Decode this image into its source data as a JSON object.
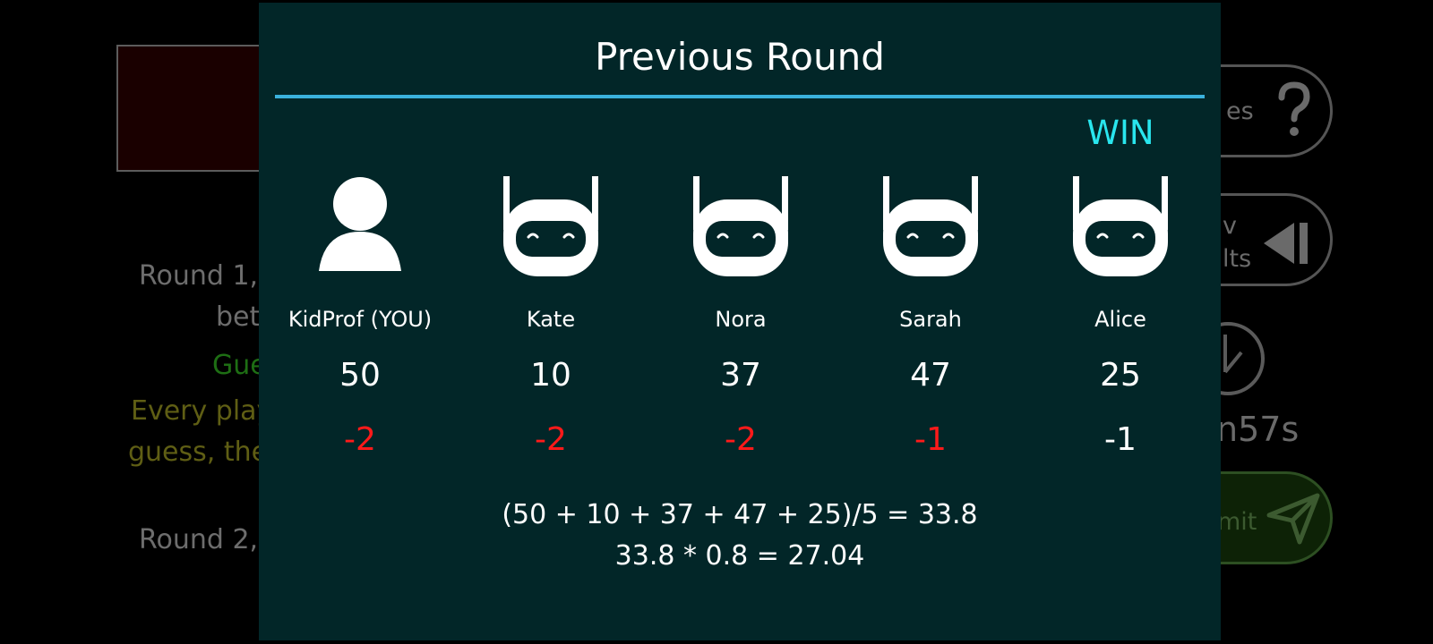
{
  "background": {
    "texts": [
      {
        "text": "Round 1,",
        "cls": "bg-gray"
      },
      {
        "text": "bet",
        "cls": "bg-gray"
      },
      {
        "text": "Gue",
        "cls": "bg-green"
      },
      {
        "text": "Every play",
        "cls": "bg-olive"
      },
      {
        "text": "guess, the",
        "cls": "bg-olive"
      },
      {
        "text": "Round 2,",
        "cls": "bg-gray"
      }
    ],
    "side_buttons": {
      "rules_partial": "es",
      "prev_results_line1": "v",
      "prev_results_line2": "lts",
      "timer_partial": "n57s",
      "submit_partial": "mit"
    }
  },
  "modal": {
    "title": "Previous Round",
    "win_label": "WIN",
    "players": [
      {
        "name": "KidProf (YOU)",
        "guess": "50",
        "score": "-2",
        "type": "human",
        "winner": false
      },
      {
        "name": "Kate",
        "guess": "10",
        "score": "-2",
        "type": "robot",
        "winner": false
      },
      {
        "name": "Nora",
        "guess": "37",
        "score": "-2",
        "type": "robot",
        "winner": false
      },
      {
        "name": "Sarah",
        "guess": "47",
        "score": "-1",
        "type": "robot",
        "winner": false
      },
      {
        "name": "Alice",
        "guess": "25",
        "score": "-1",
        "type": "robot",
        "winner": true
      }
    ],
    "formula_line1": "(50 + 10 + 37 + 47 + 25)/5 = 33.8",
    "formula_line2": "33.8 * 0.8 = 27.04"
  },
  "colors": {
    "modal_bg": "#022628",
    "divider": "#3ab1dc",
    "win": "#29e6ee",
    "loss_score": "#ff1a1a",
    "winner_score": "#ffffff"
  },
  "icons": {
    "human": "person-icon",
    "robot": "robot-icon",
    "rules": "question-mark-icon",
    "prev_results": "skip-back-icon",
    "timer": "clock-icon",
    "submit": "send-icon"
  }
}
